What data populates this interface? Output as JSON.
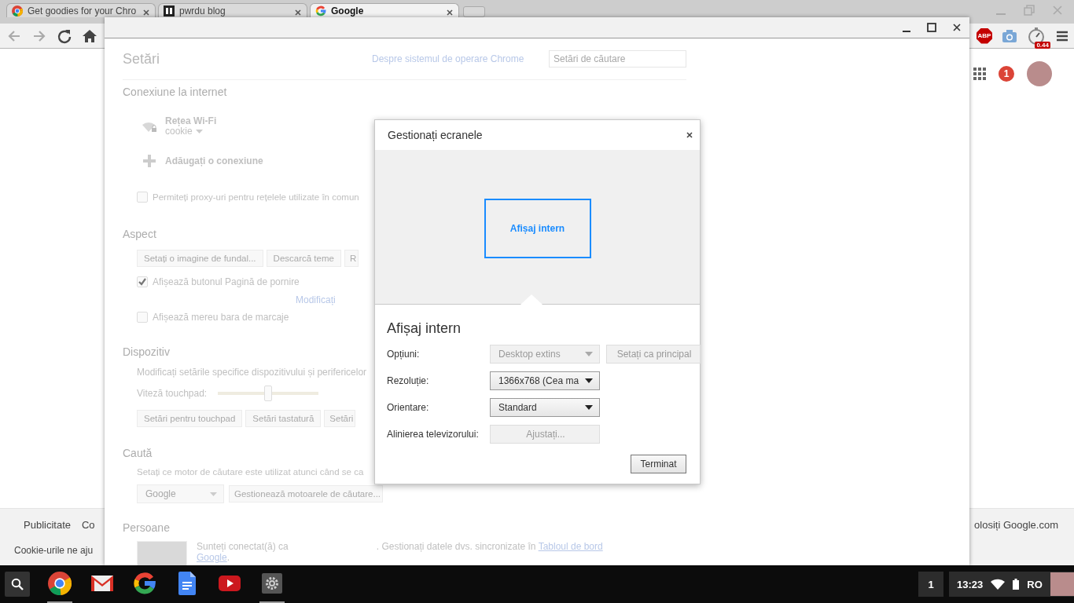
{
  "browser": {
    "tabs": [
      {
        "title": "Get goodies for your Chro",
        "kind": "chrome",
        "selected": false
      },
      {
        "title": "pwrdu blog",
        "kind": "blog",
        "selected": false
      },
      {
        "title": "Google",
        "kind": "google",
        "selected": true
      }
    ],
    "extensions": {
      "abp_label": "ABP",
      "timer_reading": "0.44"
    },
    "notification_count": "1",
    "footer": {
      "links": [
        "Publicitate",
        "Co"
      ],
      "right_link": "olosiți Google.com",
      "cookie_notice": "Cookie-urile ne aju"
    }
  },
  "settings": {
    "title": "Setări",
    "about_link": "Despre sistemul de operare Chrome",
    "search": {
      "placeholder": "Setări de căutare"
    },
    "internet": {
      "heading": "Conexiune la internet",
      "wifi": {
        "label": "Rețea Wi-Fi",
        "network": "cookie"
      },
      "add_connection": "Adăugați o conexiune",
      "proxy": {
        "label": "Permiteți proxy-uri pentru rețelele utilizate în comun",
        "checked": false
      }
    },
    "appearance": {
      "heading": "Aspect",
      "buttons": [
        "Setați o imagine de fundal...",
        "Descarcă teme",
        "R"
      ],
      "options": [
        {
          "label": "Afișează butonul Pagină de pornire",
          "checked": true,
          "link": "Modificați"
        },
        {
          "label": "Afișează mereu bara de marcaje",
          "checked": false
        }
      ]
    },
    "device": {
      "heading": "Dispozitiv",
      "description": "Modificați setările specifice dispozitivului și perifericelor",
      "touchpad": {
        "label": "Viteză touchpad:",
        "level": 0.5
      },
      "buttons": [
        "Setări pentru touchpad",
        "Setări tastatură",
        "Setări"
      ]
    },
    "search_engine": {
      "heading": "Caută",
      "description": "Setați ce motor de căutare este utilizat atunci când se ca",
      "engine": "Google",
      "manage_button": "Gestionează motoarele de căutare..."
    },
    "people": {
      "heading": "Persoane",
      "signed_in_text": "Sunteți conectat(ă) ca",
      "sync_text": ". Gestionați datele dvs. sincronizate în",
      "dashboard_link": "Tabloul de bord",
      "google_link": "Google",
      "end": "."
    }
  },
  "dialog": {
    "title": "Gestionați ecranele",
    "displays": [
      {
        "name": "Afișaj intern",
        "selected": true
      }
    ],
    "heading": "Afișaj intern",
    "rows": [
      {
        "label": "Opțiuni:",
        "kind": "select",
        "value": "Desktop extins",
        "disabled": true,
        "extra_button": {
          "label": "Setați ca principal",
          "disabled": true
        }
      },
      {
        "label": "Rezoluție:",
        "kind": "select",
        "value": "1366x768 (Cea ma",
        "disabled": false
      },
      {
        "label": "Orientare:",
        "kind": "select",
        "value": "Standard",
        "disabled": false
      },
      {
        "label": "Alinierea televizorului:",
        "kind": "button",
        "value": "Ajustați...",
        "disabled": true
      }
    ],
    "done_button": "Terminat"
  },
  "taskbar": {
    "apps": [
      {
        "kind": "chrome",
        "running": true
      },
      {
        "kind": "gmail",
        "running": false
      },
      {
        "kind": "google",
        "running": false
      },
      {
        "kind": "docs",
        "running": false
      },
      {
        "kind": "youtube",
        "running": false
      },
      {
        "kind": "settings",
        "running": true
      }
    ],
    "notification_count": "1",
    "time": "13:23",
    "input_method": "RO"
  }
}
